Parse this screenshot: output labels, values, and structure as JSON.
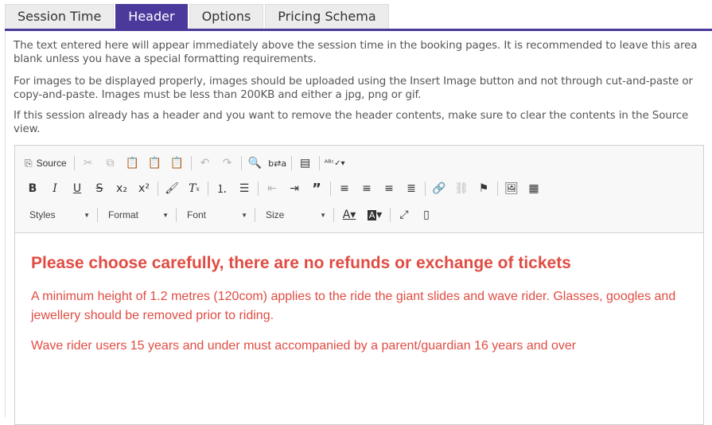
{
  "tabs": [
    {
      "label": "Session Time",
      "active": false
    },
    {
      "label": "Header",
      "active": true
    },
    {
      "label": "Options",
      "active": false
    },
    {
      "label": "Pricing Schema",
      "active": false
    }
  ],
  "accent_color": "#4b3a9c",
  "description": [
    "The text entered here will appear immediately above the session time in the booking pages. It is recommended to leave this area blank unless you have a special formatting requirements.",
    "For images to be displayed properly, images should be uploaded using the Insert Image button and not through cut-and-paste or copy-and-paste. Images must be less than 200KB and either a jpg, png or gif.",
    "If this session already has a header and you want to remove the header contents, make sure to clear the contents in the Source view."
  ],
  "toolbar": {
    "source_label": "Source",
    "styles_label": "Styles",
    "format_label": "Format",
    "font_label": "Font",
    "size_label": "Size"
  },
  "content": {
    "color": "#e04c43",
    "heading": "Please choose carefully, there are no refunds or exchange of tickets",
    "paragraph1": "A minimum height of 1.2 metres (120com) applies to the ride the giant slides and wave rider. Glasses, googles and jewellery should be removed prior to riding.",
    "paragraph2": "Wave rider users 15 years and under must accompanied by a parent/guardian 16 years and over"
  }
}
